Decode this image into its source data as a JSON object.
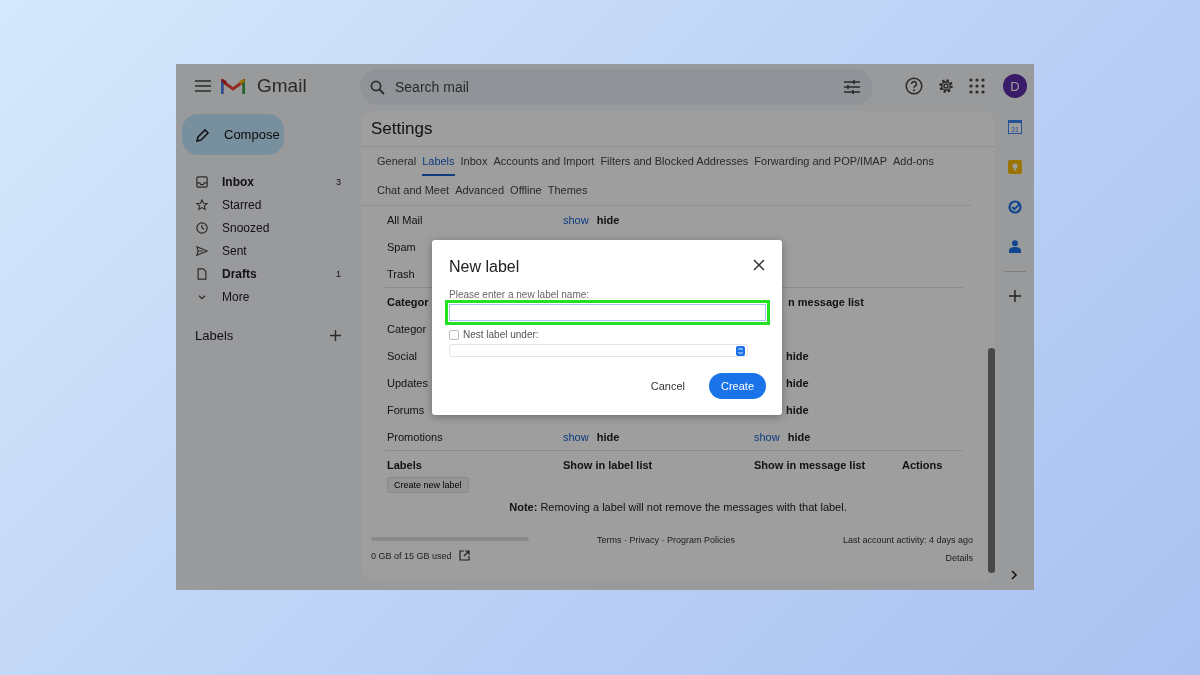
{
  "app": {
    "name": "Gmail"
  },
  "search": {
    "placeholder": "Search mail"
  },
  "account": {
    "initial": "D"
  },
  "compose": "Compose",
  "sidebar": {
    "items": [
      {
        "kind": "inbox",
        "label": "Inbox",
        "count": "3",
        "unread": true
      },
      {
        "kind": "starred",
        "label": "Starred",
        "unread": false
      },
      {
        "kind": "snoozed",
        "label": "Snoozed",
        "unread": false
      },
      {
        "kind": "sent",
        "label": "Sent",
        "unread": false
      },
      {
        "kind": "drafts",
        "label": "Drafts",
        "count": "1",
        "unread": true
      },
      {
        "kind": "more",
        "label": "More",
        "unread": false
      }
    ],
    "labels_heading": "Labels"
  },
  "settings": {
    "title": "Settings",
    "tabs": [
      [
        {
          "label": "General",
          "selected": false
        },
        {
          "label": "Labels",
          "selected": true
        },
        {
          "label": "Inbox",
          "selected": false
        },
        {
          "label": "Accounts and Import",
          "selected": false
        },
        {
          "label": "Filters and Blocked Addresses",
          "selected": false
        },
        {
          "label": "Forwarding and POP/IMAP",
          "selected": false
        },
        {
          "label": "Add-ons",
          "selected": false
        }
      ],
      [
        {
          "label": "Chat and Meet",
          "selected": false
        },
        {
          "label": "Advanced",
          "selected": false
        },
        {
          "label": "Offline",
          "selected": false
        },
        {
          "label": "Themes",
          "selected": false
        }
      ]
    ],
    "rows": [
      {
        "kind": "row",
        "name": "All Mail",
        "label_show": "show",
        "label_hide": "hide"
      },
      {
        "kind": "row",
        "name": "Spam"
      },
      {
        "kind": "row",
        "name": "Trash"
      },
      {
        "kind": "header",
        "name": "Categor",
        "message_list": "n message list"
      },
      {
        "kind": "row",
        "name": "Categor"
      },
      {
        "kind": "row",
        "name": "Social",
        "message_hide": "hide"
      },
      {
        "kind": "row",
        "name": "Updates",
        "message_hide": "hide"
      },
      {
        "kind": "row",
        "name": "Forums",
        "message_hide": "hide"
      },
      {
        "kind": "row",
        "name": "Promotions",
        "label_show": "show",
        "label_hide": "hide",
        "message_show": "show",
        "message_hide": "hide"
      },
      {
        "kind": "header",
        "name": "Labels",
        "label_list": "Show in label list",
        "message_list": "Show in message list",
        "actions": "Actions"
      }
    ],
    "create_button": "Create new label",
    "note": "**Note:** Removing a label will not remove the messages with that label."
  },
  "footer": {
    "storage": "0 GB of 15 GB used",
    "links": "Terms · Privacy · Program Policies",
    "activity": "Last account activity: 4 days ago",
    "details": "Details"
  },
  "rail": {
    "calendar_day": "31"
  },
  "dialog": {
    "title": "New label",
    "field_label": "Please enter a new label name:",
    "nest": {
      "label": "Nest label under:",
      "checked": false
    },
    "buttons": [
      {
        "label": "Cancel",
        "kind": "text"
      },
      {
        "label": "Create",
        "kind": "primary"
      }
    ]
  }
}
